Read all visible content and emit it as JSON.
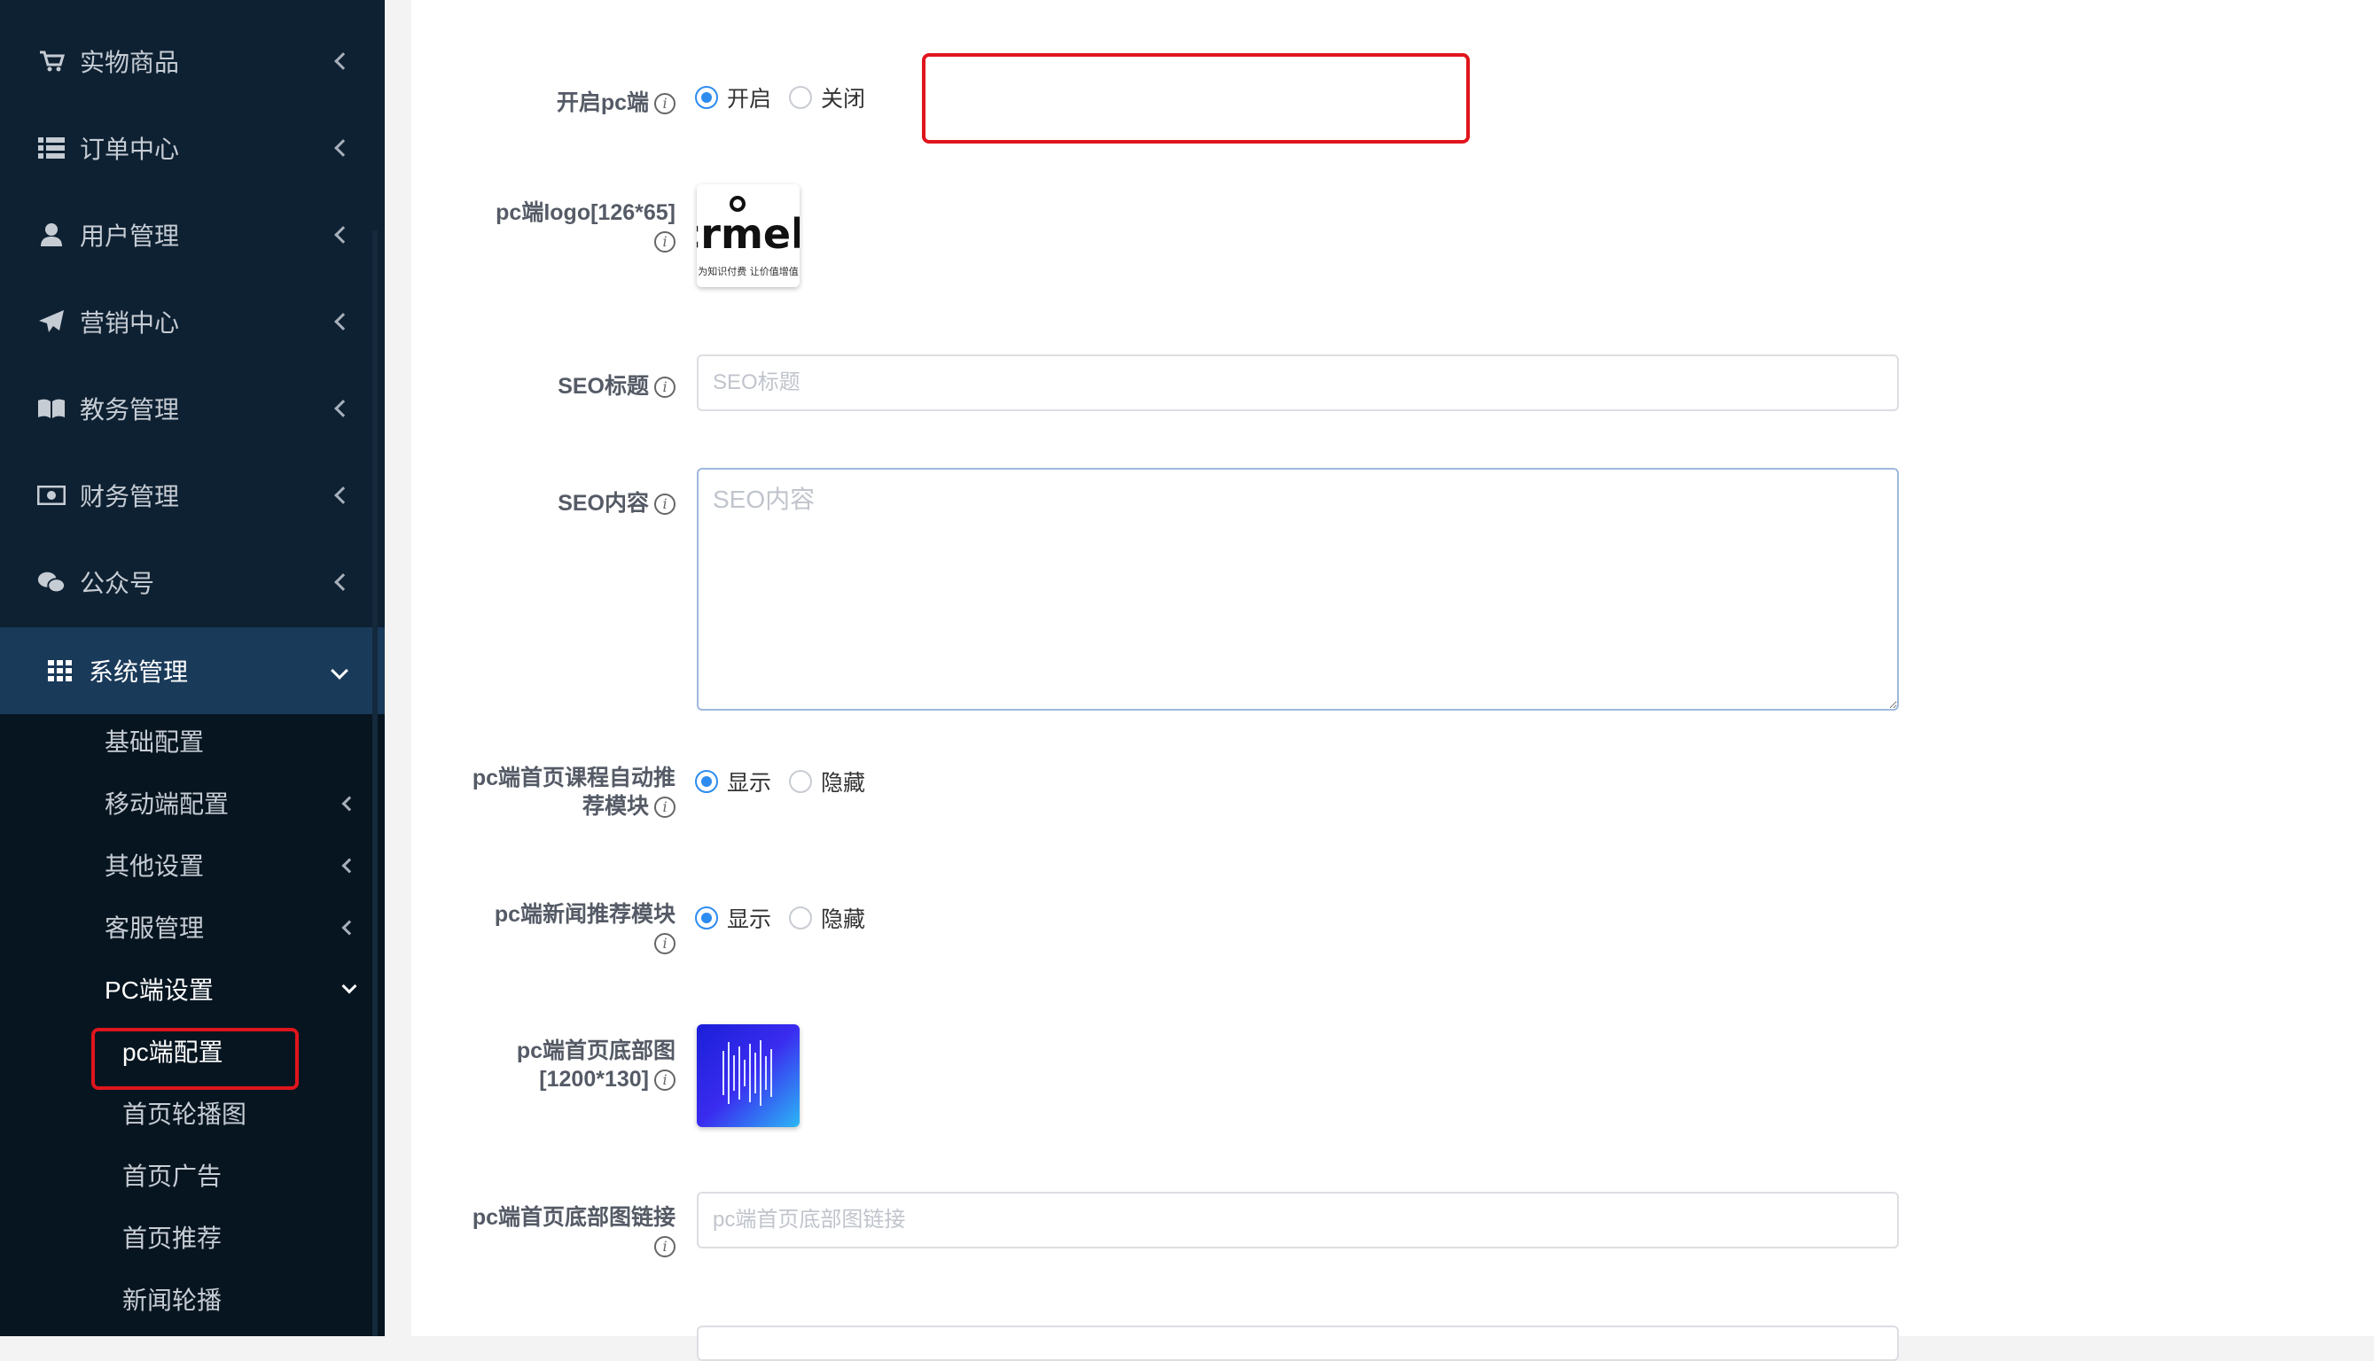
{
  "sidebar": {
    "items": [
      {
        "label": "实物商品",
        "icon": "cart-icon"
      },
      {
        "label": "订单中心",
        "icon": "list-icon"
      },
      {
        "label": "用户管理",
        "icon": "user-icon"
      },
      {
        "label": "营销中心",
        "icon": "paper-plane-icon"
      },
      {
        "label": "教务管理",
        "icon": "book-icon"
      },
      {
        "label": "财务管理",
        "icon": "money-icon"
      },
      {
        "label": "公众号",
        "icon": "wechat-icon"
      },
      {
        "label": "系统管理",
        "icon": "grid-icon"
      }
    ],
    "sub_items": [
      {
        "label": "基础配置"
      },
      {
        "label": "移动端配置"
      },
      {
        "label": "其他设置"
      },
      {
        "label": "客服管理"
      },
      {
        "label": "PC端设置"
      }
    ],
    "pc_items": [
      {
        "label": "pc端配置"
      },
      {
        "label": "首页轮播图"
      },
      {
        "label": "首页广告"
      },
      {
        "label": "首页推荐"
      },
      {
        "label": "新闻轮播"
      }
    ]
  },
  "form": {
    "enable_pc": {
      "label": "开启pc端",
      "options": [
        "开启",
        "关闭"
      ],
      "selected": "开启"
    },
    "pc_logo": {
      "label": "pc端logo[126*65]",
      "logo_text": "crmeb",
      "logo_sub": "为知识付费 让价值增值"
    },
    "seo_title": {
      "label": "SEO标题",
      "placeholder": "SEO标题",
      "value": ""
    },
    "seo_content": {
      "label": "SEO内容",
      "placeholder": "SEO内容",
      "value": ""
    },
    "auto_recommend": {
      "label_line1": "pc端首页课程自动推",
      "label_line2": "荐模块",
      "options": [
        "显示",
        "隐藏"
      ],
      "selected": "显示"
    },
    "news_recommend": {
      "label": "pc端新闻推荐模块",
      "options": [
        "显示",
        "隐藏"
      ],
      "selected": "显示"
    },
    "footer_image": {
      "label_line1": "pc端首页底部图",
      "label_line2": "[1200*130]"
    },
    "footer_link": {
      "label": "pc端首页底部图链接",
      "placeholder": "pc端首页底部图链接",
      "value": ""
    }
  },
  "colors": {
    "sidebar_bg": "#0e2132",
    "sidebar_active": "#1a3a5a",
    "accent": "#2d8cf0",
    "highlight_border": "#e0151d"
  }
}
